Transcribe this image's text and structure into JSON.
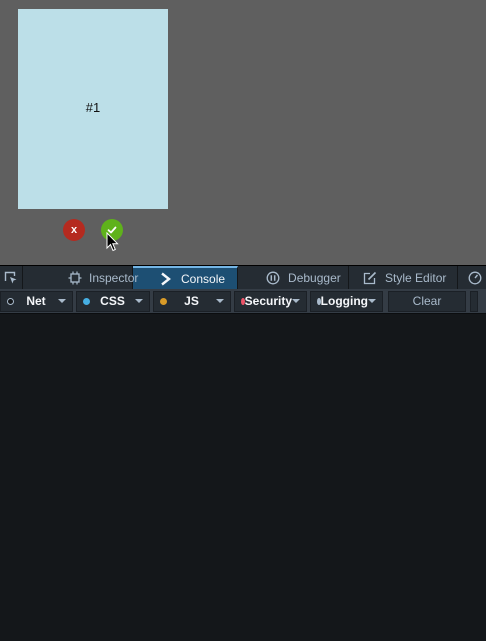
{
  "page": {
    "card": {
      "label": "#1",
      "color": "#bcdfe8"
    },
    "reject_button": {
      "label": "x",
      "color": "#b52a1f"
    },
    "accept_button": {
      "icon": "check-icon",
      "color": "#5fb21b"
    }
  },
  "devtools": {
    "tabs": [
      {
        "label": "",
        "icon": "element-picker-icon"
      },
      {
        "label": "Inspector",
        "icon": "inspector-icon"
      },
      {
        "label": "Console",
        "icon": "console-icon",
        "active": true
      },
      {
        "label": "Debugger",
        "icon": "debugger-icon"
      },
      {
        "label": "Style Editor",
        "icon": "style-editor-icon"
      },
      {
        "label": "",
        "icon": "performance-icon"
      }
    ],
    "filters": [
      {
        "label": "Net",
        "dot_color": "#14171a"
      },
      {
        "label": "CSS",
        "dot_color": "#46afe3"
      },
      {
        "label": "JS",
        "dot_color": "#d99b28"
      },
      {
        "label": "Security",
        "dot_color": "#eb5368"
      },
      {
        "label": "Logging",
        "dot_color": "#a9bacb"
      }
    ],
    "clear_label": "Clear",
    "colors": {
      "toolbar": "#252c33",
      "active_tab": "#1d4f73",
      "output_bg": "#14171a"
    }
  }
}
